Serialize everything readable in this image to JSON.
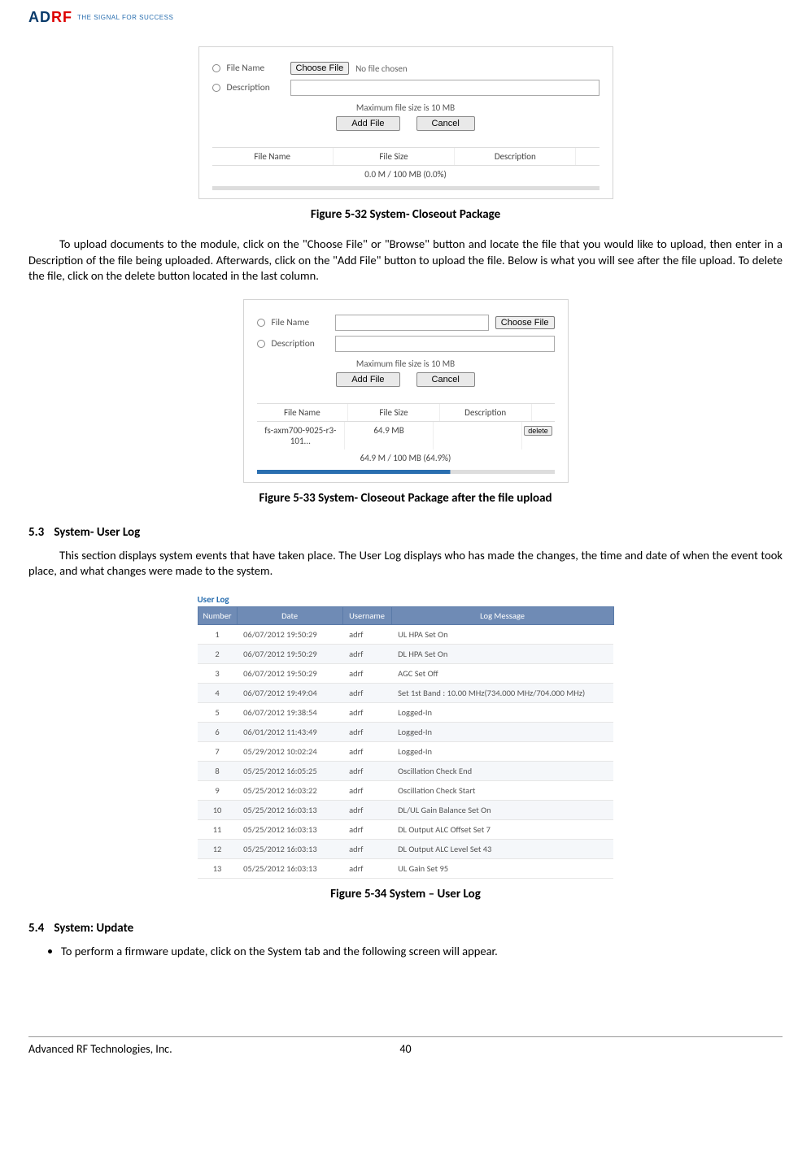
{
  "header": {
    "logo_prefix": "AD",
    "logo_suffix": "RF",
    "tagline": "THE SIGNAL FOR SUCCESS"
  },
  "figure_532": {
    "form": {
      "filename_label": "File Name",
      "description_label": "Description",
      "choose_btn": "Choose File",
      "no_file": "No file chosen",
      "max_note": "Maximum file size is 10 MB",
      "add_btn": "Add File",
      "cancel_btn": "Cancel"
    },
    "table": {
      "h1": "File Name",
      "h2": "File Size",
      "h3": "Description",
      "usage": "0.0 M / 100 MB (0.0%)"
    },
    "caption": "Figure 5-32   System- Closeout Package"
  },
  "para_upload": "To upload documents to the module, click on the \"Choose File\" or \"Browse\" button and locate the file that you would like to upload, then enter in a Description of the file being uploaded.  Afterwards, click on the \"Add File\" button to upload the file.  Below is what you will see after the file upload.  To delete the file, click on the delete button located in the last column.",
  "figure_533": {
    "form": {
      "filename_label": "File Name",
      "description_label": "Description",
      "choose_btn": "Choose File",
      "max_note": "Maximum file size is 10 MB",
      "add_btn": "Add File",
      "cancel_btn": "Cancel"
    },
    "table": {
      "h1": "File Name",
      "h2": "File Size",
      "h3": "Description",
      "row_name": "fs-axm700-9025-r3-101...",
      "row_size": "64.9 MB",
      "delete_btn": "delete",
      "usage": "64.9 M / 100 MB (64.9%)"
    },
    "caption": "Figure 5-33   System- Closeout Package after the file upload"
  },
  "section_53": {
    "num": "5.3",
    "title": "System- User Log"
  },
  "para_userlog": "This section displays system events that have taken place.  The User Log displays who has made the changes, the time and date of when the event took place, and what changes were made to the system.",
  "userlog": {
    "title": "User Log",
    "head": {
      "number": "Number",
      "date": "Date",
      "username": "Username",
      "msg": "Log Message"
    },
    "rows": [
      {
        "n": "1",
        "date": "06/07/2012 19:50:29",
        "user": "adrf",
        "msg": "UL HPA Set On"
      },
      {
        "n": "2",
        "date": "06/07/2012 19:50:29",
        "user": "adrf",
        "msg": "DL HPA Set On"
      },
      {
        "n": "3",
        "date": "06/07/2012 19:50:29",
        "user": "adrf",
        "msg": "AGC Set Off"
      },
      {
        "n": "4",
        "date": "06/07/2012 19:49:04",
        "user": "adrf",
        "msg": "Set 1st Band : 10.00 MHz(734.000 MHz/704.000 MHz)"
      },
      {
        "n": "5",
        "date": "06/07/2012 19:38:54",
        "user": "adrf",
        "msg": "Logged-In"
      },
      {
        "n": "6",
        "date": "06/01/2012 11:43:49",
        "user": "adrf",
        "msg": "Logged-In"
      },
      {
        "n": "7",
        "date": "05/29/2012 10:02:24",
        "user": "adrf",
        "msg": "Logged-In"
      },
      {
        "n": "8",
        "date": "05/25/2012 16:05:25",
        "user": "adrf",
        "msg": "Oscillation Check End"
      },
      {
        "n": "9",
        "date": "05/25/2012 16:03:22",
        "user": "adrf",
        "msg": "Oscillation Check Start"
      },
      {
        "n": "10",
        "date": "05/25/2012 16:03:13",
        "user": "adrf",
        "msg": "DL/UL Gain Balance Set On"
      },
      {
        "n": "11",
        "date": "05/25/2012 16:03:13",
        "user": "adrf",
        "msg": "DL Output ALC Offset Set 7"
      },
      {
        "n": "12",
        "date": "05/25/2012 16:03:13",
        "user": "adrf",
        "msg": "DL Output ALC Level Set 43"
      },
      {
        "n": "13",
        "date": "05/25/2012 16:03:13",
        "user": "adrf",
        "msg": "UL Gain Set 95"
      }
    ]
  },
  "figure_534_caption": "Figure 5-34   System – User Log",
  "section_54": {
    "num": "5.4",
    "title": "System: Update"
  },
  "bullet_update": "To perform a firmware update, click on the System tab and the following screen will appear.",
  "footer": {
    "company": "Advanced RF Technologies, Inc.",
    "page": "40"
  }
}
